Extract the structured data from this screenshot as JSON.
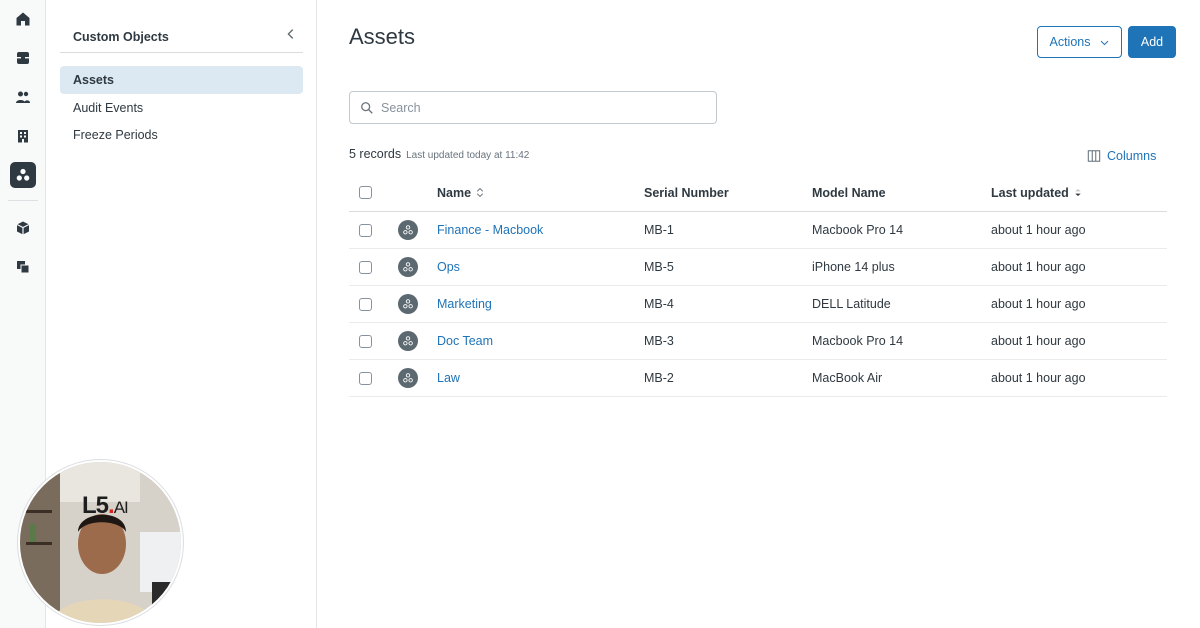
{
  "rail": {
    "items": [
      {
        "icon": "home-icon"
      },
      {
        "icon": "inbox-icon"
      },
      {
        "icon": "users-icon"
      },
      {
        "icon": "building-icon"
      },
      {
        "icon": "custom-objects-icon",
        "active": true
      },
      {
        "icon": "cube-icon"
      },
      {
        "icon": "copy-icon"
      }
    ]
  },
  "subnav": {
    "title": "Custom Objects",
    "items": [
      {
        "label": "Assets",
        "active": true
      },
      {
        "label": "Audit Events"
      },
      {
        "label": "Freeze Periods"
      }
    ]
  },
  "main": {
    "title": "Assets",
    "actions_label": "Actions",
    "add_label": "Add",
    "search_placeholder": "Search",
    "records_count": "5 records",
    "records_updated": "Last updated today at 11:42",
    "columns_label": "Columns"
  },
  "table": {
    "headers": {
      "name": "Name",
      "serial": "Serial Number",
      "model": "Model Name",
      "updated": "Last updated"
    },
    "rows": [
      {
        "name": "Finance - Macbook",
        "serial": "MB-1",
        "model": "Macbook Pro 14",
        "updated": "about 1 hour ago"
      },
      {
        "name": "Ops",
        "serial": "MB-5",
        "model": "iPhone 14 plus",
        "updated": "about 1 hour ago"
      },
      {
        "name": "Marketing",
        "serial": "MB-4",
        "model": "DELL Latitude",
        "updated": "about 1 hour ago"
      },
      {
        "name": "Doc Team",
        "serial": "MB-3",
        "model": "Macbook Pro 14",
        "updated": "about 1 hour ago"
      },
      {
        "name": "Law",
        "serial": "MB-2",
        "model": "MacBook Air",
        "updated": "about 1 hour ago"
      }
    ]
  },
  "webcam": {
    "logo_text": "L5.AI"
  },
  "colors": {
    "accent": "#1f73b7",
    "text": "#2f3941",
    "active_nav_bg": "#dde9f2",
    "rail_active_bg": "#2f3941"
  }
}
